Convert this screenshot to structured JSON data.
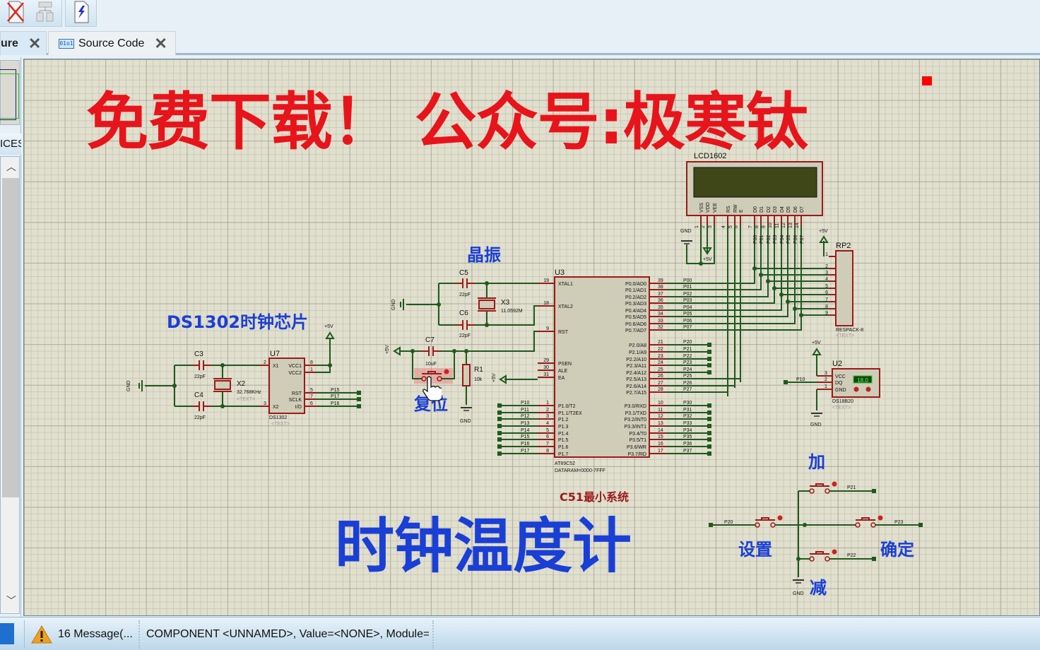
{
  "toolbar": {
    "buttons": [
      {
        "name": "remove-tool-icon"
      },
      {
        "name": "hierarchy-tool-icon"
      },
      {
        "name": "netlist-tool-icon"
      }
    ]
  },
  "tabs": [
    {
      "label": "ure",
      "active": true
    },
    {
      "label": "Source Code",
      "active": false,
      "icon_text": "01o1"
    }
  ],
  "left_panel": {
    "devices_header": "ICES"
  },
  "schematic": {
    "banner_title": "免费下载！ 公众号:极寒钛",
    "project_title": "时钟温度计",
    "section_labels": {
      "crystal": "晶振",
      "ds1302": "DS1302时钟芯片",
      "reset": "复位",
      "min_system": "C51最小系统",
      "add": "加",
      "set": "设置",
      "confirm": "确定",
      "sub": "减"
    },
    "colors": {
      "banner": "#e8141b",
      "label_blue": "#1a3fd6",
      "wire": "#1e5a1e",
      "pin": "#9a1a1a",
      "component_fill": "#cfccb8"
    },
    "lcd": {
      "ref": "LCD1602",
      "pins": [
        "VSS",
        "VDD",
        "VEE",
        "RS",
        "RW",
        "E",
        "D0",
        "D1",
        "D2",
        "D3",
        "D4",
        "D5",
        "D6",
        "D7"
      ],
      "pin_numbers": [
        "1",
        "2",
        "3",
        "4",
        "5",
        "6",
        "7",
        "8",
        "9",
        "10",
        "11",
        "12",
        "13",
        "14"
      ],
      "net_labels": [
        "P00",
        "P01",
        "P02",
        "P03",
        "P04",
        "P05",
        "P06",
        "P07"
      ],
      "gnd": "GND",
      "vcc": "+5V"
    },
    "rp2": {
      "ref": "RP2",
      "value": "RESPACK-8",
      "text": "<TEXT>",
      "vcc": "+5V",
      "pins": [
        "1",
        "2",
        "3",
        "4",
        "5",
        "6",
        "7",
        "8",
        "9"
      ]
    },
    "mcu": {
      "ref": "U3",
      "part": "AT89C52",
      "dataram": "DATARAM=0000-7FFF",
      "left_pins": [
        {
          "num": "19",
          "name": "XTAL1"
        },
        {
          "num": "18",
          "name": "XTAL2"
        },
        {
          "num": "9",
          "name": "RST"
        },
        {
          "num": "29",
          "name": "PSEN"
        },
        {
          "num": "30",
          "name": "ALE"
        },
        {
          "num": "31",
          "name": "EA"
        },
        {
          "num": "1",
          "name": "P1.0/T2",
          "net": "P10"
        },
        {
          "num": "2",
          "name": "P1.1/T2EX",
          "net": "P11"
        },
        {
          "num": "3",
          "name": "P1.2",
          "net": "P12"
        },
        {
          "num": "4",
          "name": "P1.3",
          "net": "P13"
        },
        {
          "num": "5",
          "name": "P1.4",
          "net": "P14"
        },
        {
          "num": "6",
          "name": "P1.5",
          "net": "P15"
        },
        {
          "num": "7",
          "name": "P1.6",
          "net": "P16"
        },
        {
          "num": "8",
          "name": "P1.7",
          "net": "P17"
        }
      ],
      "right_pins": [
        {
          "num": "39",
          "name": "P0.0/AD0",
          "net": "P00"
        },
        {
          "num": "38",
          "name": "P0.1/AD1",
          "net": "P01"
        },
        {
          "num": "37",
          "name": "P0.2/AD2",
          "net": "P02"
        },
        {
          "num": "36",
          "name": "P0.3/AD3",
          "net": "P03"
        },
        {
          "num": "35",
          "name": "P0.4/AD4",
          "net": "P04"
        },
        {
          "num": "34",
          "name": "P0.5/AD5",
          "net": "P05"
        },
        {
          "num": "33",
          "name": "P0.6/AD6",
          "net": "P06"
        },
        {
          "num": "32",
          "name": "P0.7/AD7",
          "net": "P07"
        },
        {
          "num": "21",
          "name": "P2.0/A8",
          "net": "P20"
        },
        {
          "num": "22",
          "name": "P2.1/A9",
          "net": "P21"
        },
        {
          "num": "23",
          "name": "P2.2/A10",
          "net": "P22"
        },
        {
          "num": "24",
          "name": "P2.3/A11",
          "net": "P23"
        },
        {
          "num": "25",
          "name": "P2.4/A12",
          "net": "P24"
        },
        {
          "num": "26",
          "name": "P2.5/A13",
          "net": "P25"
        },
        {
          "num": "27",
          "name": "P2.6/A14",
          "net": "P26"
        },
        {
          "num": "28",
          "name": "P2.7/A15",
          "net": "P27"
        },
        {
          "num": "10",
          "name": "P3.0/RXD",
          "net": "P30"
        },
        {
          "num": "11",
          "name": "P3.1/TXD",
          "net": "P31"
        },
        {
          "num": "12",
          "name": "P3.2/INT0",
          "net": "P32"
        },
        {
          "num": "13",
          "name": "P3.3/INT1",
          "net": "P33"
        },
        {
          "num": "14",
          "name": "P3.4/T0",
          "net": "P34"
        },
        {
          "num": "15",
          "name": "P3.5/T1",
          "net": "P35"
        },
        {
          "num": "16",
          "name": "P3.6/WR",
          "net": "P36"
        },
        {
          "num": "17",
          "name": "P3.7/RD",
          "net": "P37"
        }
      ],
      "ea_supply": "+5V"
    },
    "crystal": {
      "c5": {
        "ref": "C5",
        "value": "22pF"
      },
      "c6": {
        "ref": "C6",
        "value": "22pF"
      },
      "x3": {
        "ref": "X3",
        "value": "11.0592M"
      },
      "gnd": "GND"
    },
    "reset": {
      "c7": {
        "ref": "C7",
        "value": "10uF"
      },
      "r1": {
        "ref": "R1",
        "value": "10k"
      },
      "supply": "+5V",
      "gnd": "GND"
    },
    "ds1302": {
      "ref": "U7",
      "part": "DS1302",
      "text": "<TEXT>",
      "c3": {
        "ref": "C3",
        "value": "22pF"
      },
      "c4": {
        "ref": "C4",
        "value": "22pF"
      },
      "x2": {
        "ref": "X2",
        "value": "32.768KHz",
        "text": "<TEXT>"
      },
      "pins": [
        {
          "num": "2",
          "name": "X1"
        },
        {
          "num": "3",
          "name": "X2"
        },
        {
          "num": "8",
          "name": "VCC1"
        },
        {
          "num": "1",
          "name": "VCC2"
        },
        {
          "num": "5",
          "name": "RST",
          "net": "P15"
        },
        {
          "num": "7",
          "name": "SCLK",
          "net": "P17"
        },
        {
          "num": "6",
          "name": "I/O",
          "net": "P16"
        }
      ],
      "supply": "+5V",
      "gnd": "GND"
    },
    "ds18b20": {
      "ref": "U2",
      "part": "DS18B20",
      "text": "<TEXT>",
      "reading": "18.0",
      "pins": [
        {
          "num": "3",
          "name": "VCC"
        },
        {
          "num": "2",
          "name": "DQ",
          "net": "P10"
        },
        {
          "num": "1",
          "name": "GND"
        }
      ],
      "supply": "+5V",
      "gnd": "GND"
    },
    "keys": {
      "nets": [
        "P20",
        "P21",
        "P22",
        "P23"
      ],
      "gnd": "GND"
    }
  },
  "statusbar": {
    "messages": "16 Message(...",
    "component_info": "COMPONENT <UNNAMED>, Value=<NONE>, Module=<"
  }
}
